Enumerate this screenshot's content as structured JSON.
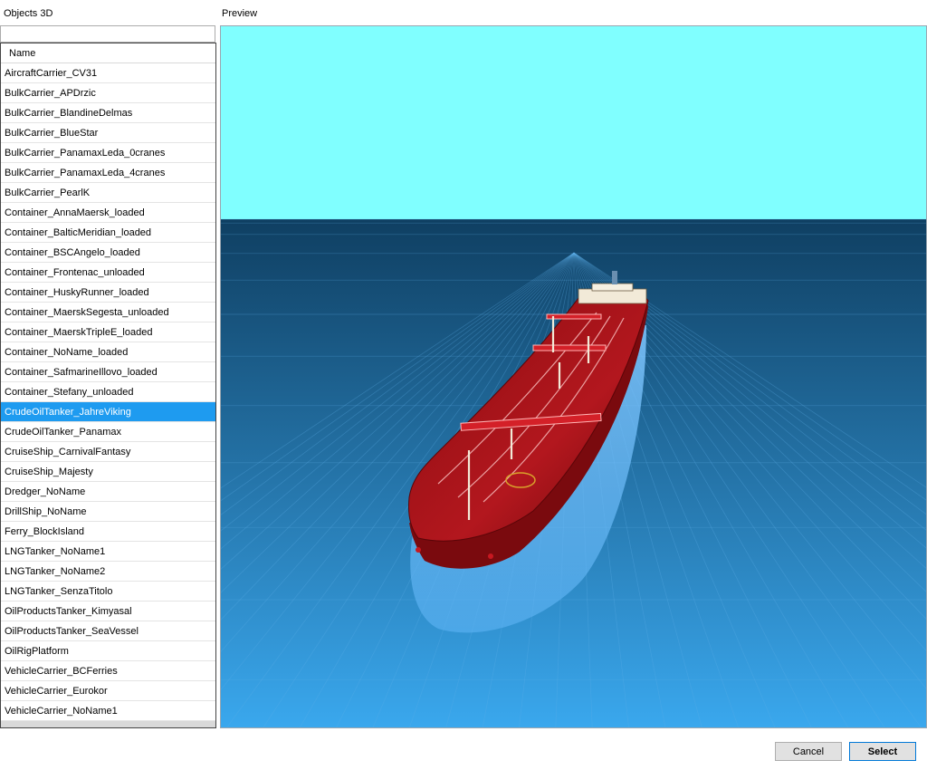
{
  "window": {
    "objects_label": "Objects 3D",
    "preview_label": "Preview"
  },
  "filter": {
    "value": ""
  },
  "list": {
    "header": "Name",
    "selected_index": 17,
    "items": [
      "AircraftCarrier_CV31",
      "BulkCarrier_APDrzic",
      "BulkCarrier_BlandineDelmas",
      "BulkCarrier_BlueStar",
      "BulkCarrier_PanamaxLeda_0cranes",
      "BulkCarrier_PanamaxLeda_4cranes",
      "BulkCarrier_PearlK",
      "Container_AnnaMaersk_loaded",
      "Container_BalticMeridian_loaded",
      "Container_BSCAngelo_loaded",
      "Container_Frontenac_unloaded",
      "Container_HuskyRunner_loaded",
      "Container_MaerskSegesta_unloaded",
      "Container_MaerskTripleE_loaded",
      "Container_NoName_loaded",
      "Container_SafmarineIllovo_loaded",
      "Container_Stefany_unloaded",
      "CrudeOilTanker_JahreViking",
      "CrudeOilTanker_Panamax",
      "CruiseShip_CarnivalFantasy",
      "CruiseShip_Majesty",
      "Dredger_NoName",
      "DrillShip_NoName",
      "Ferry_BlockIsland",
      "LNGTanker_NoName1",
      "LNGTanker_NoName2",
      "LNGTanker_SenzaTitolo",
      "OilProductsTanker_Kimyasal",
      "OilProductsTanker_SeaVessel",
      "OilRigPlatform",
      "VehicleCarrier_BCFerries",
      "VehicleCarrier_Eurokor",
      "VehicleCarrier_NoName1"
    ]
  },
  "preview": {
    "sky_color": "#80ffff",
    "sea_top_color": "#0f3f62",
    "sea_bottom_color": "#3aa8ee",
    "hull_color": "#9c0f14",
    "deck_color": "#b01820",
    "model_icon": "ship-3d-model"
  },
  "buttons": {
    "cancel": "Cancel",
    "select": "Select"
  },
  "colors": {
    "selection": "#1e9bf0",
    "default_button_border": "#0078d7"
  }
}
